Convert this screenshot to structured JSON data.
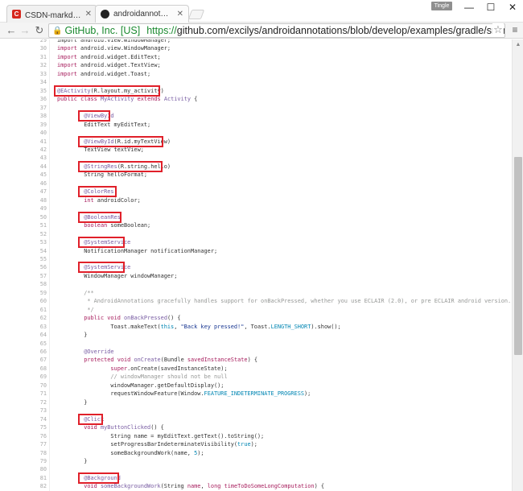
{
  "browser": {
    "tabs": [
      {
        "label": "CSDN-markdown编辑器",
        "favicon": "C"
      },
      {
        "label": "androidannotations/My"
      }
    ],
    "profile_label": "Tingle",
    "url_identity": "GitHub, Inc. [US]",
    "url_scheme": "https://",
    "url_rest": "github.com/excilys/androidannotations/blob/develop/examples/gradle/src/main/java/org/andr"
  },
  "code": {
    "lines": [
      {
        "n": "29",
        "html": "import android.view.WindowManager;"
      },
      {
        "n": "30",
        "html": "<span class=\"kw\">import</span> android.view.WindowManager;"
      },
      {
        "n": "31",
        "html": "<span class=\"kw\">import</span> android.widget.EditText;"
      },
      {
        "n": "32",
        "html": "<span class=\"kw\">import</span> android.widget.TextView;"
      },
      {
        "n": "33",
        "html": "<span class=\"kw\">import</span> android.widget.Toast;"
      },
      {
        "n": "34",
        "html": ""
      },
      {
        "n": "35",
        "html": "<span class=\"ann\">@EActivity</span>(R.layout.my_activity)"
      },
      {
        "n": "36",
        "html": "<span class=\"kw\">public</span> <span class=\"kw\">class</span> <span class=\"fn\">MyActivity</span> <span class=\"kw\">extends</span> <span class=\"fn\">Activity</span> {"
      },
      {
        "n": "37",
        "html": ""
      },
      {
        "n": "38",
        "html": "        <span class=\"ann\">@ViewById</span>"
      },
      {
        "n": "39",
        "html": "        EditText myEditText;"
      },
      {
        "n": "40",
        "html": ""
      },
      {
        "n": "41",
        "html": "        <span class=\"ann\">@ViewById</span>(R.id.myTextView)"
      },
      {
        "n": "42",
        "html": "        TextView textView;"
      },
      {
        "n": "43",
        "html": ""
      },
      {
        "n": "44",
        "html": "        <span class=\"ann\">@StringRes</span>(R.string.hello)"
      },
      {
        "n": "45",
        "html": "        String helloFormat;"
      },
      {
        "n": "46",
        "html": ""
      },
      {
        "n": "47",
        "html": "        <span class=\"ann\">@ColorRes</span>"
      },
      {
        "n": "48",
        "html": "        <span class=\"kw\">int</span> androidColor;"
      },
      {
        "n": "49",
        "html": ""
      },
      {
        "n": "50",
        "html": "        <span class=\"ann\">@BooleanRes</span>"
      },
      {
        "n": "51",
        "html": "        <span class=\"kw\">boolean</span> someBoolean;"
      },
      {
        "n": "52",
        "html": ""
      },
      {
        "n": "53",
        "html": "        <span class=\"ann\">@SystemService</span>"
      },
      {
        "n": "54",
        "html": "        NotificationManager notificationManager;"
      },
      {
        "n": "55",
        "html": ""
      },
      {
        "n": "56",
        "html": "        <span class=\"ann\">@SystemService</span>"
      },
      {
        "n": "57",
        "html": "        WindowManager windowManager;"
      },
      {
        "n": "58",
        "html": ""
      },
      {
        "n": "59",
        "html": "        <span class=\"com\">/**</span>"
      },
      {
        "n": "60",
        "html": "<span class=\"com\">         * AndroidAnnotations gracefully handles support for onBackPressed, whether you use ECLAIR (2.0), or pre ECLAIR android version.</span>"
      },
      {
        "n": "61",
        "html": "<span class=\"com\">         */</span>"
      },
      {
        "n": "62",
        "html": "        <span class=\"kw\">public</span> <span class=\"kw\">void</span> <span class=\"fn\">onBackPressed</span>() {"
      },
      {
        "n": "63",
        "html": "                Toast.makeText(<span class=\"con\">this</span>, <span class=\"str\">\"Back key pressed!\"</span>, Toast.<span class=\"con\">LENGTH_SHORT</span>).show();"
      },
      {
        "n": "64",
        "html": "        }"
      },
      {
        "n": "65",
        "html": ""
      },
      {
        "n": "66",
        "html": "        <span class=\"ann\">@Override</span>"
      },
      {
        "n": "67",
        "html": "        <span class=\"kw\">protected</span> <span class=\"kw\">void</span> <span class=\"fn\">onCreate</span>(Bundle <span class=\"kw\">savedInstanceState</span>) {"
      },
      {
        "n": "68",
        "html": "                <span class=\"kw\">super</span>.onCreate(savedInstanceState);"
      },
      {
        "n": "69",
        "html": "                <span class=\"com\">// windowManager should not be null</span>"
      },
      {
        "n": "70",
        "html": "                windowManager.getDefaultDisplay();"
      },
      {
        "n": "71",
        "html": "                requestWindowFeature(Window.<span class=\"con\">FEATURE_INDETERMINATE_PROGRESS</span>);"
      },
      {
        "n": "72",
        "html": "        }"
      },
      {
        "n": "73",
        "html": ""
      },
      {
        "n": "74",
        "html": "        <span class=\"ann\">@Click</span>"
      },
      {
        "n": "75",
        "html": "        <span class=\"kw\">void</span> <span class=\"fn\">myButtonClicked</span>() {"
      },
      {
        "n": "76",
        "html": "                String name = myEditText.getText().toString();"
      },
      {
        "n": "77",
        "html": "                setProgressBarIndeterminateVisibility(<span class=\"con\">true</span>);"
      },
      {
        "n": "78",
        "html": "                someBackgroundWork(name, <span class=\"con\">5</span>);"
      },
      {
        "n": "79",
        "html": "        }"
      },
      {
        "n": "80",
        "html": ""
      },
      {
        "n": "81",
        "html": "        <span class=\"ann\">@Background</span>"
      },
      {
        "n": "82",
        "html": "        <span class=\"kw\">void</span> <span class=\"fn\">someBackgroundWork</span>(String <span class=\"kw\">name</span>, <span class=\"kw\">long</span> <span class=\"kw\">timeToDoSomeLongComputation</span>) {"
      }
    ]
  },
  "colors": {
    "highlight": "#e0202a",
    "keyword": "#a71d5d",
    "annotation": "#795da3",
    "string": "#183691",
    "comment": "#969896",
    "constant": "#0086b3"
  }
}
